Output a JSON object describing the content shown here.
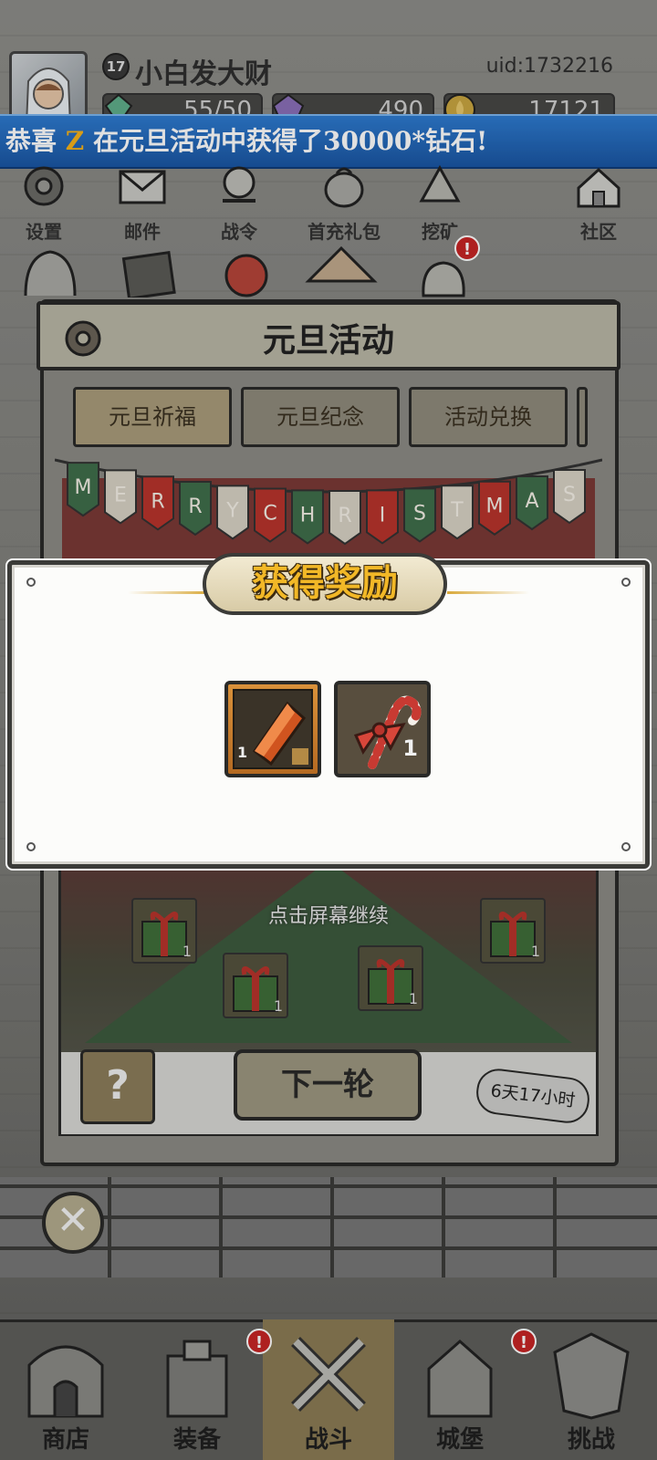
{
  "player": {
    "level": "17",
    "name": "小白发大财",
    "uid": "uid:1732216"
  },
  "resources": {
    "stamina": "55/50",
    "purple": "490",
    "gold": "17121"
  },
  "banner": {
    "prefix": "恭喜",
    "player_name": "Z",
    "suffix": "在元旦活动中获得了30000*钻石!"
  },
  "top_icons": [
    {
      "label": "设置",
      "icon": "gear-icon"
    },
    {
      "label": "邮件",
      "icon": "mail-icon"
    },
    {
      "label": "战令",
      "icon": "battle-pass-icon"
    },
    {
      "label": "首充礼包",
      "icon": "first-recharge-icon"
    },
    {
      "label": "挖矿",
      "icon": "mining-icon"
    },
    {
      "label": "社区",
      "icon": "community-icon"
    }
  ],
  "badges": {
    "icon_row2": "!",
    "nav_equip": "!",
    "nav_castle": "!"
  },
  "panel": {
    "title": "元旦活动",
    "tabs": [
      "元旦祈福",
      "元旦纪念",
      "活动兑换"
    ],
    "garland_letters": [
      "M",
      "E",
      "R",
      "R",
      "Y",
      "C",
      "H",
      "R",
      "I",
      "S",
      "T",
      "M",
      "A",
      "S"
    ],
    "hint": "点击屏幕继续",
    "next_button": "下一轮",
    "timer": "6天17小时",
    "mystery": "?",
    "gift_qty": "1"
  },
  "reward_dialog": {
    "title": "获得奖励",
    "items": [
      {
        "name": "orange-crystal",
        "qty": "1"
      },
      {
        "name": "candy-cane-bow",
        "qty": "1"
      }
    ]
  },
  "close_button": "✕",
  "bottom_nav": [
    {
      "label": "商店",
      "icon": "shop-icon"
    },
    {
      "label": "装备",
      "icon": "equipment-icon"
    },
    {
      "label": "战斗",
      "icon": "battle-icon"
    },
    {
      "label": "城堡",
      "icon": "castle-icon"
    },
    {
      "label": "挑战",
      "icon": "challenge-icon"
    }
  ],
  "colors": {
    "banner_blue": "#1a56a3",
    "highlight_orange": "#f5b21a",
    "reward_gold": "#f2b827",
    "alert_red": "#c62525"
  }
}
